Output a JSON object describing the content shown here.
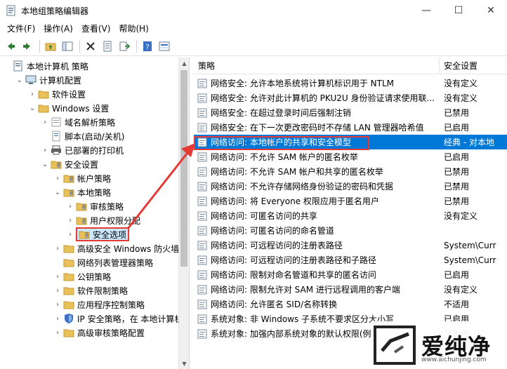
{
  "window": {
    "title": "本地组策略编辑器",
    "minimize": "—",
    "maximize": "☐",
    "close": "✕"
  },
  "menu": [
    "文件(F)",
    "操作(A)",
    "查看(V)",
    "帮助(H)"
  ],
  "tree": [
    {
      "label": "本地计算机 策略",
      "indent": 0,
      "chevron": "",
      "icon": "computer-policy-icon"
    },
    {
      "label": "计算机配置",
      "indent": 1,
      "chevron": "expanded",
      "icon": "computer-icon"
    },
    {
      "label": "软件设置",
      "indent": 2,
      "chevron": "collapsed",
      "icon": "folder-icon"
    },
    {
      "label": "Windows 设置",
      "indent": 2,
      "chevron": "expanded",
      "icon": "folder-icon"
    },
    {
      "label": "域名解析策略",
      "indent": 3,
      "chevron": "collapsed",
      "icon": "policy-list-icon"
    },
    {
      "label": "脚本(启动/关机)",
      "indent": 3,
      "chevron": "",
      "icon": "script-icon"
    },
    {
      "label": "已部署的打印机",
      "indent": 3,
      "chevron": "collapsed",
      "icon": "printer-icon"
    },
    {
      "label": "安全设置",
      "indent": 3,
      "chevron": "expanded",
      "icon": "security-folder-icon"
    },
    {
      "label": "帐户策略",
      "indent": 4,
      "chevron": "collapsed",
      "icon": "security-folder-icon"
    },
    {
      "label": "本地策略",
      "indent": 4,
      "chevron": "expanded",
      "icon": "security-folder-icon"
    },
    {
      "label": "审核策略",
      "indent": 5,
      "chevron": "collapsed",
      "icon": "security-folder-icon"
    },
    {
      "label": "用户权限分配",
      "indent": 5,
      "chevron": "collapsed",
      "icon": "security-folder-icon"
    },
    {
      "label": "安全选项",
      "indent": 5,
      "chevron": "collapsed",
      "icon": "security-folder-icon",
      "selected": true
    },
    {
      "label": "高级安全 Windows 防火墙",
      "indent": 4,
      "chevron": "collapsed",
      "icon": "folder-icon"
    },
    {
      "label": "网络列表管理器策略",
      "indent": 4,
      "chevron": "",
      "icon": "folder-icon"
    },
    {
      "label": "公钥策略",
      "indent": 4,
      "chevron": "collapsed",
      "icon": "folder-icon"
    },
    {
      "label": "软件限制策略",
      "indent": 4,
      "chevron": "collapsed",
      "icon": "folder-icon"
    },
    {
      "label": "应用程序控制策略",
      "indent": 4,
      "chevron": "collapsed",
      "icon": "folder-icon"
    },
    {
      "label": "IP 安全策略，在 本地计算机",
      "indent": 4,
      "chevron": "collapsed",
      "icon": "shield-icon"
    },
    {
      "label": "高级审核策略配置",
      "indent": 4,
      "chevron": "collapsed",
      "icon": "folder-icon"
    }
  ],
  "columns": {
    "policy": "策略",
    "setting": "安全设置"
  },
  "policies": [
    {
      "name": "网络安全: 允许本地系统将计算机标识用于 NTLM",
      "value": "没有定义"
    },
    {
      "name": "网络安全: 允许对此计算机的 PKU2U 身份验证请求使用联...",
      "value": "没有定义"
    },
    {
      "name": "网络安全: 在超过登录时间后强制注销",
      "value": "已禁用"
    },
    {
      "name": "网络安全: 在下一次更改密码时不存储 LAN 管理器哈希值",
      "value": "已启用"
    },
    {
      "name": "网络访问: 本地帐户的共享和安全模型",
      "value": "经典 - 对本地",
      "highlight": true
    },
    {
      "name": "网络访问: 不允许 SAM 帐户的匿名枚举",
      "value": "已启用"
    },
    {
      "name": "网络访问: 不允许 SAM 帐户和共享的匿名枚举",
      "value": "已禁用"
    },
    {
      "name": "网络访问: 不允许存储网络身份验证的密码和凭据",
      "value": "已禁用"
    },
    {
      "name": "网络访问: 将 Everyone 权限应用于匿名用户",
      "value": "已禁用"
    },
    {
      "name": "网络访问: 可匿名访问的共享",
      "value": "没有定义"
    },
    {
      "name": "网络访问: 可匿名访问的命名管道",
      "value": ""
    },
    {
      "name": "网络访问: 可远程访问的注册表路径",
      "value": "System\\Curr"
    },
    {
      "name": "网络访问: 可远程访问的注册表路径和子路径",
      "value": "System\\Curr"
    },
    {
      "name": "网络访问: 限制对命名管道和共享的匿名访问",
      "value": "已启用"
    },
    {
      "name": "网络访问: 限制允许对 SAM 进行远程调用的客户端",
      "value": "没有定义"
    },
    {
      "name": "网络访问: 允许匿名 SID/名称转换",
      "value": "不适用"
    },
    {
      "name": "系统对象: 非 Windows 子系统不要求区分大小写",
      "value": "已启用"
    },
    {
      "name": "系统对象: 加强内部系统对象的默认权限(例",
      "value": "已启用"
    }
  ],
  "watermark": {
    "text": "爱纯净",
    "url": "www.aichunjing.com"
  },
  "colors": {
    "selection": "#0078d7",
    "annotation": "#e53935"
  }
}
